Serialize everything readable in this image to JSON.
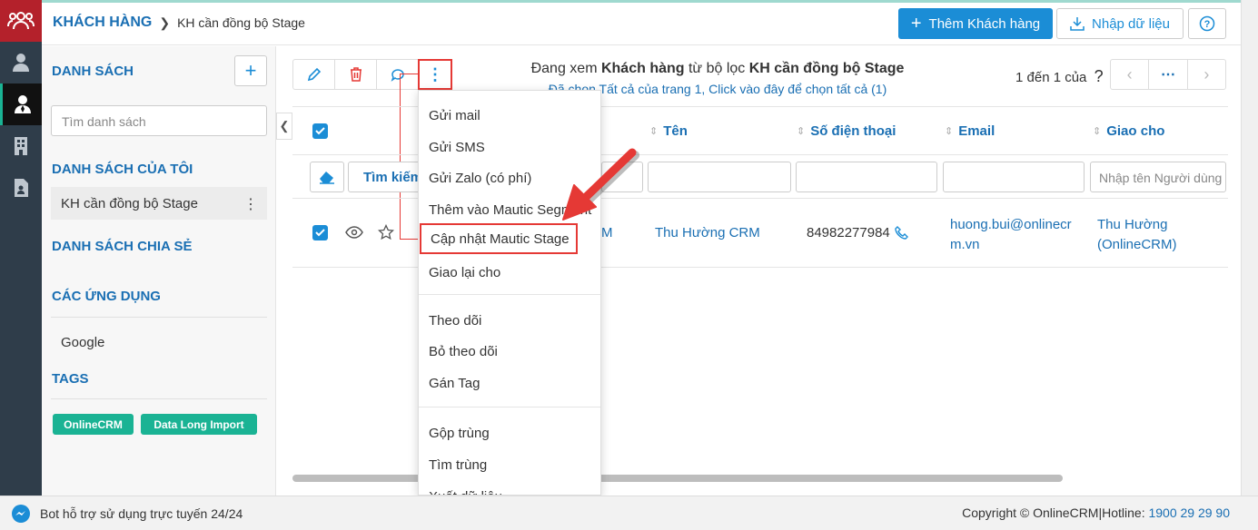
{
  "header": {
    "breadcrumb_root": "KHÁCH HÀNG",
    "breadcrumb_current": "KH cần đồng bộ Stage",
    "add_customer": "Thêm Khách hàng",
    "import_data": "Nhập dữ liệu"
  },
  "sidebar": {
    "lists_title": "DANH SÁCH",
    "search_placeholder": "Tìm danh sách",
    "my_lists_title": "DANH SÁCH CỦA TÔI",
    "my_list_item": "KH cần đồng bộ Stage",
    "shared_title": "DANH SÁCH CHIA SẺ",
    "apps_title": "CÁC ỨNG DỤNG",
    "app_item": "Google",
    "tags_title": "TAGS",
    "tags": [
      "OnlineCRM",
      "Data Long Import"
    ]
  },
  "main": {
    "viewing_prefix": "Đang xem ",
    "viewing_entity": "Khách hàng",
    "viewing_middle": " từ bộ lọc ",
    "viewing_filter": "KH cần đồng bộ Stage",
    "select_all": "Đã chọn Tất cả của trang 1, Click vào đây để chọn tất cả (1)",
    "page_info": "1 đến 1 của",
    "page_unknown": "?",
    "columns": [
      "Tên",
      "Số điện thoại",
      "Email",
      "Giao cho"
    ],
    "filter_find": "Tìm kiếm",
    "filter_user_placeholder": "Nhập tên Người dùng",
    "row": {
      "name_partial": "M",
      "name": "Thu Hường CRM",
      "phone": "84982277984",
      "email_line1": "huong.bui@onlinecr",
      "email_line2": "m.vn",
      "assignee_line1": "Thu Hường",
      "assignee_line2": "(OnlineCRM)"
    }
  },
  "menu": {
    "items": [
      "Gửi mail",
      "Gửi SMS",
      "Gửi Zalo (có phí)",
      "Thêm vào Mautic Segment",
      "Cập nhật Mautic Stage",
      "Giao lại cho",
      "Theo dõi",
      "Bỏ theo dõi",
      "Gán Tag",
      "Gộp trùng",
      "Tìm trùng",
      "Xuất dữ liệu"
    ]
  },
  "footer": {
    "bot_text": "Bot hỗ trợ sử dụng trực tuyến 24/24",
    "copyright": "Copyright © OnlineCRM|Hotline: ",
    "hotline": "1900 29 29 90"
  },
  "colors": {
    "primary": "#1b8dd6",
    "rail": "#2f3d4a",
    "brand": "#b4212b",
    "tag": "#1ab394",
    "highlight": "#e53935"
  }
}
